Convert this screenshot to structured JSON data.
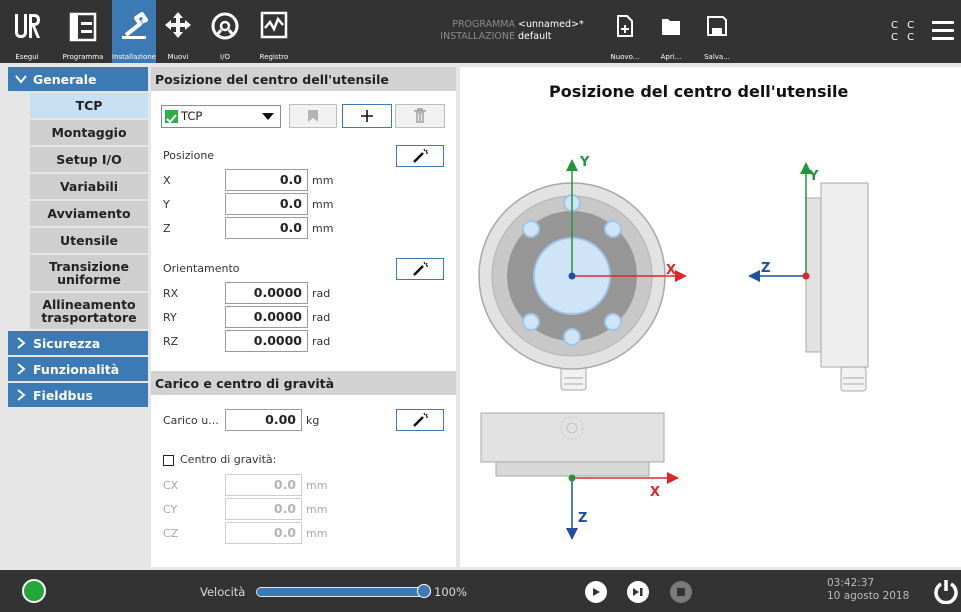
{
  "topbar": {
    "nav": [
      {
        "id": "run",
        "label": "Esegui",
        "icon": "ur-logo-icon"
      },
      {
        "id": "program",
        "label": "Programma",
        "icon": "program-tree-icon"
      },
      {
        "id": "installation",
        "label": "Installazione",
        "icon": "robot-arm-icon",
        "active": true
      },
      {
        "id": "move",
        "label": "Muovi",
        "icon": "move-arrows-icon"
      },
      {
        "id": "io",
        "label": "I/O",
        "icon": "io-gauge-icon"
      },
      {
        "id": "log",
        "label": "Registro",
        "icon": "log-graph-icon"
      }
    ],
    "program_key": "PROGRAMMA",
    "program_value": "<unnamed>*",
    "installation_key": "INSTALLAZIONE",
    "installation_value": "default",
    "file_actions": [
      {
        "id": "new",
        "label": "Nuovo...",
        "icon": "new-file-icon"
      },
      {
        "id": "open",
        "label": "Apri...",
        "icon": "folder-icon"
      },
      {
        "id": "save",
        "label": "Salva...",
        "icon": "save-disk-icon"
      }
    ],
    "cc_line1": "C C",
    "cc_line2": "C C",
    "menu_icon": "hamburger-menu-icon"
  },
  "sidebar": {
    "sections": [
      {
        "label": "Generale",
        "expanded": true
      },
      {
        "label": "Sicurezza",
        "expanded": false
      },
      {
        "label": "Funzionalità",
        "expanded": false
      },
      {
        "label": "Fieldbus",
        "expanded": false
      }
    ],
    "items": [
      {
        "label": "TCP",
        "selected": true
      },
      {
        "label": "Montaggio"
      },
      {
        "label": "Setup I/O"
      },
      {
        "label": "Variabili"
      },
      {
        "label": "Avviamento"
      },
      {
        "label": "Utensile"
      },
      {
        "label": "Transizione uniforme"
      },
      {
        "label": "Allineamento trasportatore"
      }
    ]
  },
  "tcp_panel": {
    "title": "Posizione del centro dell'utensile",
    "selector_value": "TCP",
    "position_label": "Posizione",
    "position": [
      {
        "axis": "X",
        "value": "0.0",
        "unit": "mm"
      },
      {
        "axis": "Y",
        "value": "0.0",
        "unit": "mm"
      },
      {
        "axis": "Z",
        "value": "0.0",
        "unit": "mm"
      }
    ],
    "orientation_label": "Orientamento",
    "orientation": [
      {
        "axis": "RX",
        "value": "0.0000",
        "unit": "rad"
      },
      {
        "axis": "RY",
        "value": "0.0000",
        "unit": "rad"
      },
      {
        "axis": "RZ",
        "value": "0.0000",
        "unit": "rad"
      }
    ]
  },
  "payload_panel": {
    "title": "Carico e centro di gravità",
    "payload_label": "Carico u...",
    "payload_value": "0.00",
    "payload_unit": "kg",
    "cog_checkbox_label": "Centro di gravità:",
    "cog_checked": false,
    "cog": [
      {
        "axis": "CX",
        "value": "0.0",
        "unit": "mm"
      },
      {
        "axis": "CY",
        "value": "0.0",
        "unit": "mm"
      },
      {
        "axis": "CZ",
        "value": "0.0",
        "unit": "mm"
      }
    ]
  },
  "diagram": {
    "title": "Posizione del centro dell'utensile",
    "front_x_label": "X",
    "front_y_label": "Y",
    "side_y_label": "Y",
    "side_z_label": "Z",
    "bottom_x_label": "X",
    "bottom_z_label": "Z",
    "colors": {
      "x_axis": "#e0262d",
      "y_axis": "#22963a",
      "z_axis": "#1e4fa5"
    }
  },
  "bottombar": {
    "speed_label": "Velocità",
    "speed_value_text": "100%",
    "speed_fraction": 1.0,
    "time": "03:42:37",
    "date": "10 agosto 2018",
    "status_color": "#22a838"
  }
}
